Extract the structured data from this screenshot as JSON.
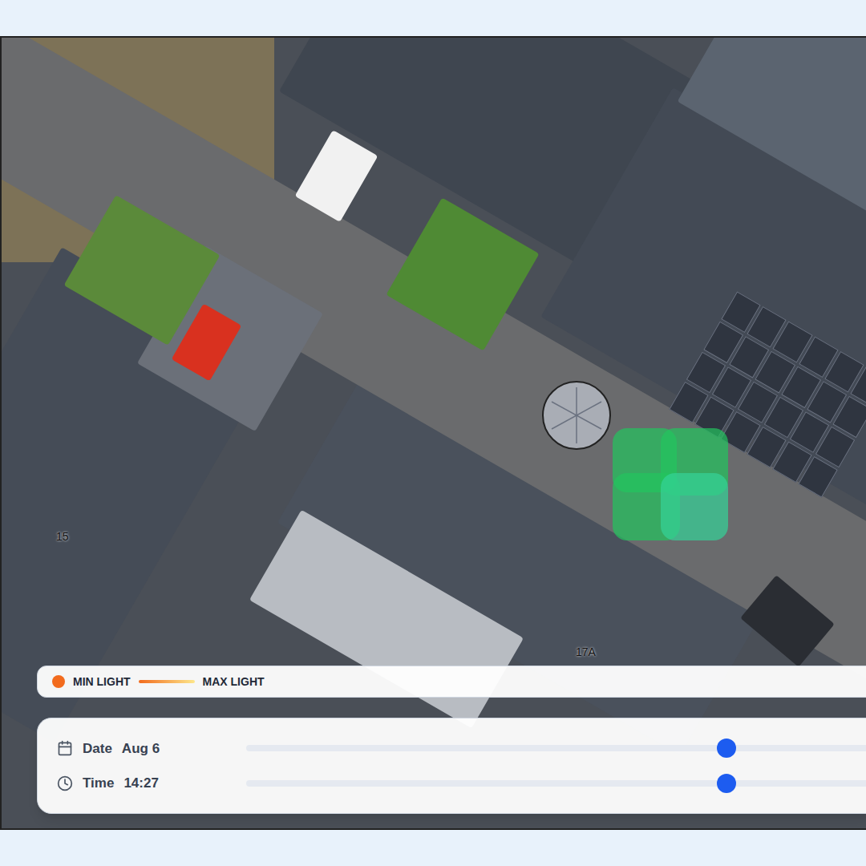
{
  "map": {
    "labels": [
      {
        "text": "15"
      },
      {
        "text": "17A"
      }
    ]
  },
  "legend": {
    "min": "MIN LIGHT",
    "max": "MAX LIGHT",
    "min_color": "#f26b1d",
    "max_color": "#fde68a"
  },
  "controls": [
    {
      "label": "Date",
      "value": "Aug 6",
      "kind": "date",
      "level": 0.77
    },
    {
      "label": "Time",
      "value": "14:27",
      "kind": "time",
      "level": 0.77
    }
  ]
}
